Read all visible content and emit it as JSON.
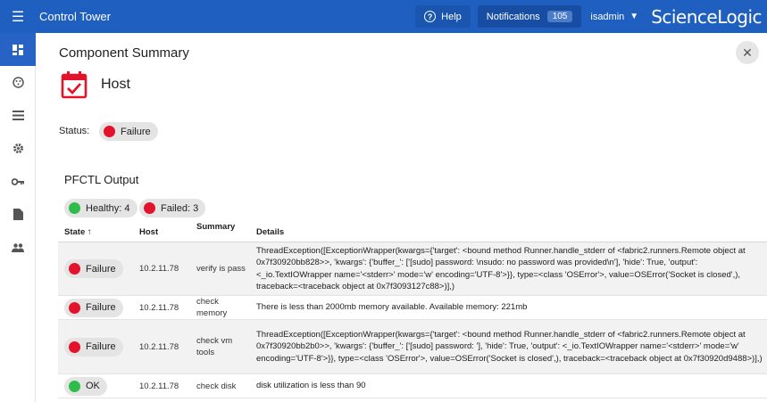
{
  "app": {
    "title": "Control Tower",
    "brand": "ScienceLogic"
  },
  "topbar": {
    "help_label": "Help",
    "notifications_label": "Notifications",
    "notifications_count": "105",
    "user": "isadmin"
  },
  "icons": [
    "menu-icon",
    "dashboard-icon",
    "palette-icon",
    "list-icon",
    "gear-icon",
    "key-icon",
    "document-icon",
    "users-icon",
    "close-icon",
    "calendar-check-icon",
    "help-icon",
    "chevron-down-icon"
  ],
  "colors": {
    "topbar": "#1f5fbf",
    "failure": "#e3132c",
    "ok": "#2ebc4a",
    "host_icon": "#e3132c"
  },
  "panel": {
    "heading": "Component Summary",
    "host_title": "Host",
    "status_label": "Status:",
    "status_value": "Failure",
    "pfctl_title": "PFCTL Output",
    "healthy_label": "Healthy: 4",
    "failed_label": "Failed: 3"
  },
  "table": {
    "columns": {
      "state": "State ↑",
      "host": "Host",
      "summary": "Summary",
      "details": "Details"
    },
    "rows": [
      {
        "state": "Failure",
        "host": "10.2.11.78",
        "summary": "verify is pass",
        "details": "ThreadException([ExceptionWrapper(kwargs={'target': <bound method Runner.handle_stderr of <fabric2.runners.Remote object at 0x7f30920bb828>>, 'kwargs': {'buffer_': ['[sudo] password: \\nsudo: no password was provided\\n'], 'hide': True, 'output': <_io.TextIOWrapper name='<stderr>' mode='w' encoding='UTF-8'>}}, type=<class 'OSError'>, value=OSError('Socket is closed',), traceback=<traceback object at 0x7f3093127c88>)],)"
      },
      {
        "state": "Failure",
        "host": "10.2.11.78",
        "summary": "check memory",
        "details": "There is less than 2000mb memory available. Available memory: 221mb"
      },
      {
        "state": "Failure",
        "host": "10.2.11.78",
        "summary": "check vm tools",
        "details": "ThreadException([ExceptionWrapper(kwargs={'target': <bound method Runner.handle_stderr of <fabric2.runners.Remote object at 0x7f30920bb2b0>>, 'kwargs': {'buffer_': ['[sudo] password: '], 'hide': True, 'output': <_io.TextIOWrapper name='<stderr>' mode='w' encoding='UTF-8'>}}, type=<class 'OSError'>, value=OSError('Socket is closed',), traceback=<traceback object at 0x7f30920d9488>)],)"
      },
      {
        "state": "OK",
        "host": "10.2.11.78",
        "summary": "check disk",
        "details": "disk utilization is less than 90"
      }
    ]
  }
}
